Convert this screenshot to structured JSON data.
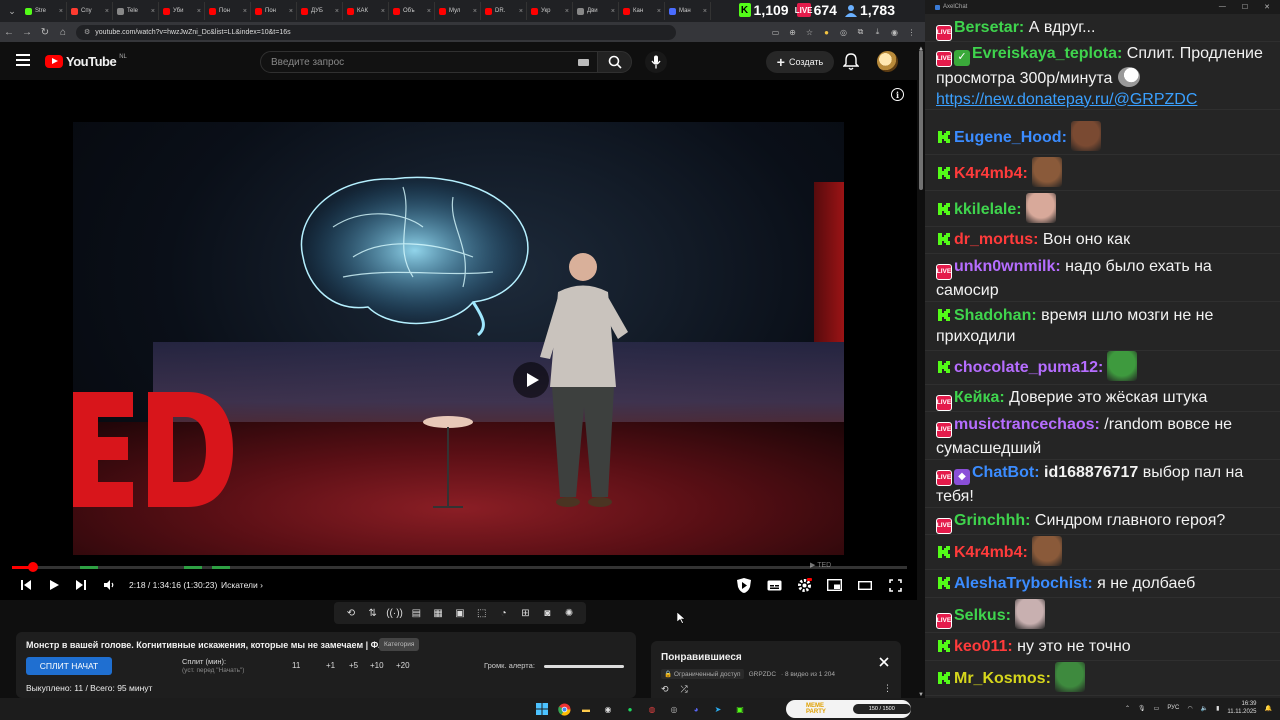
{
  "browser": {
    "tabs": [
      {
        "label": "Stre",
        "color": "#53fc18"
      },
      {
        "label": "Спу",
        "color": "#ff3b30"
      },
      {
        "label": "Tele",
        "color": "#888888"
      },
      {
        "label": "Уби",
        "color": "#ff0000"
      },
      {
        "label": "Пон",
        "color": "#ff0000"
      },
      {
        "label": "Пон",
        "color": "#ff0000"
      },
      {
        "label": "ДУБ",
        "color": "#ff0000"
      },
      {
        "label": "КАК",
        "color": "#ff0000"
      },
      {
        "label": "Объ",
        "color": "#ff0000"
      },
      {
        "label": "Мул",
        "color": "#ff0000"
      },
      {
        "label": "DR.",
        "color": "#ff0000"
      },
      {
        "label": "Укр",
        "color": "#ff0000"
      },
      {
        "label": "Дви",
        "color": "#888888"
      },
      {
        "label": "Кан",
        "color": "#ff0000"
      },
      {
        "label": "Ман",
        "color": "#4a6cff"
      }
    ],
    "url": "youtube.com/watch?v=hwzJwZni_Dc&list=LL&index=10&t=16s",
    "counters": {
      "kick": "1,109",
      "live": "674",
      "viewers": "1,783"
    }
  },
  "youtube": {
    "logo_text": "YouTube",
    "region": "NL",
    "search_placeholder": "Введите запрос",
    "create_label": "Создать"
  },
  "player": {
    "time": "2:18 / 1:34:16 (1:30:23)",
    "chapter": "Искатели",
    "chapter_arrow": "›",
    "progress_fraction": 0.024,
    "watermark": "TED"
  },
  "split": {
    "video_title": "Монстр в вашей голове. Когнитивные искажения, которые мы не замечаем | ФАЙБ",
    "category": "Категория",
    "start_button": "СПЛИТ НАЧАТ",
    "split_label": "Сплит (мин):",
    "split_hint": "(уст. перед \"Начать\")",
    "split_value": "11",
    "increments": [
      "+1",
      "+5",
      "+10",
      "+20"
    ],
    "alert_label": "Громк. алерта:",
    "used": "Выкуплено: 11 / Всего: 95 минут"
  },
  "liked": {
    "title": "Понравившиеся",
    "access": "Ограниченный доступ",
    "channel": "GRPZDC",
    "count": "· 8 видео из 1 204"
  },
  "chat": {
    "app_title": "AxelChat",
    "messages": [
      {
        "platform": "live",
        "user": "Bersetar:",
        "color": "#3fd44d",
        "text": " А вдруг..."
      },
      {
        "platform": "live",
        "user": "Evreiskaya_teplota:",
        "color": "#3fd44d",
        "text": " Сплит. Продление просмотра 300р/минута",
        "link": "https://new.donatepay.ru/@GRPZDC"
      },
      {
        "platform": "kick",
        "user": "Eugene_Hood:",
        "color": "#3b8cff",
        "text": ""
      },
      {
        "platform": "kick",
        "user": "K4r4mb4:",
        "color": "#ff3b3b",
        "text": ""
      },
      {
        "platform": "kick",
        "user": "kkilelale:",
        "color": "#3fd44d",
        "text": ""
      },
      {
        "platform": "kick",
        "user": "dr_mortus:",
        "color": "#ff3b3b",
        "text": " Вон оно как"
      },
      {
        "platform": "live",
        "user": "unkn0wnmilk:",
        "color": "#b66dff",
        "text": " надо было ехать на самосир"
      },
      {
        "platform": "kick",
        "user": "Shadohan:",
        "color": "#3fd44d",
        "text": " время шло мозги не не приходили"
      },
      {
        "platform": "kick",
        "user": "chocolate_puma12:",
        "color": "#b66dff",
        "text": ""
      },
      {
        "platform": "live",
        "user": "Кейка:",
        "color": "#3fd44d",
        "text": " Доверие это жёская штука"
      },
      {
        "platform": "live",
        "user": "musictrancechaos:",
        "color": "#b66dff",
        "text": " /random вовсе не сумасшедший"
      },
      {
        "platform": "live",
        "user": "ChatBot:",
        "color": "#3b8cff",
        "text": " выбор пал на тебя!",
        "mention": "id168876717"
      },
      {
        "platform": "live",
        "user": "Grinchhh:",
        "color": "#3fd44d",
        "text": " Синдром главного героя?"
      },
      {
        "platform": "kick",
        "user": "K4r4mb4:",
        "color": "#ff3b3b",
        "text": ""
      },
      {
        "platform": "kick",
        "user": "AleshaTrybochist:",
        "color": "#3b8cff",
        "text": " я не долбаеб"
      },
      {
        "platform": "live",
        "user": "Selkus:",
        "color": "#3fd44d",
        "text": ""
      },
      {
        "platform": "kick",
        "user": "keo011:",
        "color": "#ff3b3b",
        "text": " ну это не точно"
      },
      {
        "platform": "kick",
        "user": "Mr_Kosmos:",
        "color": "#d6d61c",
        "text": ""
      }
    ]
  },
  "taskbar": {
    "meme_title": "MEME PARTY",
    "meme_progress": "150 / 1500",
    "lang": "РУС",
    "time": "16:39",
    "date": "11.11.2025"
  }
}
